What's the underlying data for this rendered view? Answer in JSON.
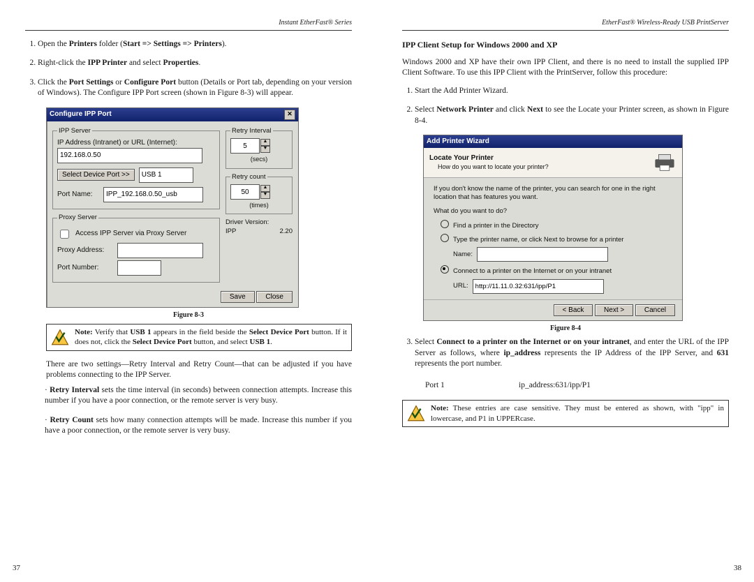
{
  "left": {
    "header": "Instant EtherFast® Series",
    "pnum": "37",
    "steps": {
      "s1_a": "Open the ",
      "s1_b": "Printers",
      "s1_c": " folder (",
      "s1_d": "Start => Settings => Printers",
      "s1_e": ").",
      "s2_a": "Right-click the ",
      "s2_b": "IPP Printer",
      "s2_c": " and select ",
      "s2_d": "Properties",
      "s2_e": ".",
      "s3_a": "Click the ",
      "s3_b": "Port Settings",
      "s3_c": " or ",
      "s3_d": "Configure Port",
      "s3_e": " button (Details or Port tab, depending on your version of Windows). The Configure IPP Port screen (shown in Figure 8-3) will appear."
    },
    "dlg": {
      "title": "Configure IPP Port",
      "close": "✕",
      "grp_server": "IPP Server",
      "lbl_ip": "IP Address (Intranet) or URL (Internet):",
      "ip_value": "192.168.0.50",
      "btn_select_port": "Select Device Port >>",
      "port_sel": "USB 1",
      "lbl_portname": "Port Name:",
      "portname_value": "IPP_192.168.0.50_usb",
      "grp_proxy": "Proxy Server",
      "chk_proxy": "Access IPP Server via Proxy Server",
      "lbl_proxyaddr": "Proxy Address:",
      "lbl_proxyport": "Port Number:",
      "grp_retryint": "Retry Interval",
      "retryint_value": "5",
      "retryint_unit": "(secs)",
      "grp_retrycnt": "Retry count",
      "retrycnt_value": "50",
      "retrycnt_unit": "(times)",
      "lbl_driverver": "Driver Version:",
      "driver_name": "IPP",
      "driver_ver": "2.20",
      "btn_save": "Save",
      "btn_close": "Close"
    },
    "fig_caption": "Figure 8-3",
    "note": {
      "a": "Note:",
      "b": " Verify that ",
      "c": "USB 1",
      "d": " appears in the field beside the ",
      "e": "Select Device Port",
      "f": " button. If it does not, click the ",
      "g": "Select Device Port",
      "h": " button, and select ",
      "i": "USB 1",
      "j": "."
    },
    "para_intro": "There are two settings—Retry Interval and Retry Count—that can be adjusted if you have problems connecting to the IPP Server.",
    "bul1_a": "Retry Interval",
    "bul1_b": " sets the time interval (in seconds) between connection attempts. Increase this number if you have a poor connection, or the remote server is very busy.",
    "bul2_a": "Retry Count",
    "bul2_b": " sets how many connection attempts will be made. Increase this number if you have a poor connection, or the remote server is very busy."
  },
  "right": {
    "header": "EtherFast® Wireless-Ready USB PrintServer",
    "pnum": "38",
    "section": "IPP Client Setup for Windows 2000 and XP",
    "intro": "Windows 2000 and XP have their own IPP Client, and there is no need to install the supplied IPP Client Software. To use this IPP Client with the PrintServer, follow this procedure:",
    "s1": "Start the Add Printer Wizard.",
    "s2_a": "Select ",
    "s2_b": "Network Printer",
    "s2_c": " and click ",
    "s2_d": "Next",
    "s2_e": " to see the Locate your Printer screen, as shown in Figure 8-4.",
    "dlg": {
      "title": "Add Printer Wizard",
      "banner_title": "Locate Your Printer",
      "banner_sub": "How do you want to locate your printer?",
      "hint": "If you don't know the name of the printer, you can search for one in the right location that has features you want.",
      "prompt": "What do you want to do?",
      "opt1": "Find a printer in the Directory",
      "opt2": "Type the printer name, or click Next to browse for a printer",
      "lbl_name": "Name:",
      "name_value": "",
      "opt3": "Connect to a printer on the Internet or on your intranet",
      "lbl_url": "URL:",
      "url_value": "http://11.11.0.32:631/ipp/P1",
      "btn_back": "< Back",
      "btn_next": "Next >",
      "btn_cancel": "Cancel"
    },
    "fig_caption": "Figure 8-4",
    "s3_a": "Select ",
    "s3_b": "Connect to a printer on the Internet or on your intranet",
    "s3_c": ", and enter the URL of the IPP Server as follows, where ",
    "s3_d": "ip_address",
    "s3_e": " represents the IP Address of the IPP Server, and ",
    "s3_f": "631",
    "s3_g": " represents the port number.",
    "port_label": "Port 1",
    "port_url": "ip_address:631/ipp/P1",
    "note": {
      "a": "Note:",
      "b": " These entries are case sensitive. They must be entered as shown, with \"ipp\" in lowercase, and P1 in UPPERcase."
    }
  }
}
